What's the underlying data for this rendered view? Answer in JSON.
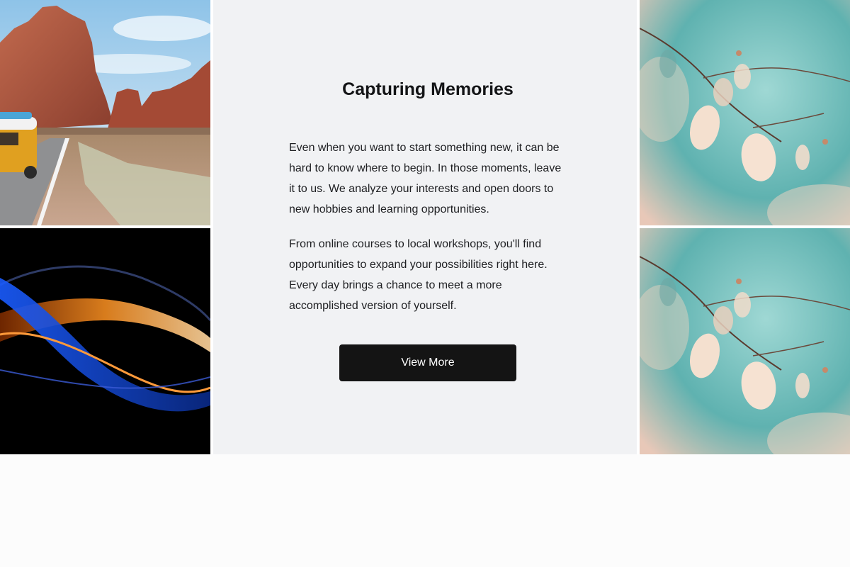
{
  "gallery": {
    "left_top_image": "desert-road-van-photo",
    "left_bottom_image": "abstract-light-waves-photo",
    "right_top_image": "teal-leaf-branch-photo",
    "right_bottom_image": "teal-leaf-branch-photo"
  },
  "feature": {
    "title": "Capturing Memories",
    "paragraph_1": "Even when you want to start something new, it can be hard to know where to begin. In those moments, leave it to us. We analyze your interests and open doors to new hobbies and learning opportunities.",
    "paragraph_2": "From online courses to local workshops, you'll find opportunities to expand your possibilities right here. Every day brings a chance to meet a more accomplished version of yourself.",
    "button_label": "View More"
  },
  "colors": {
    "panel_bg": "#f1f2f4",
    "button_bg": "#141414",
    "button_text": "#ffffff",
    "page_bg": "#fcfcfc"
  }
}
